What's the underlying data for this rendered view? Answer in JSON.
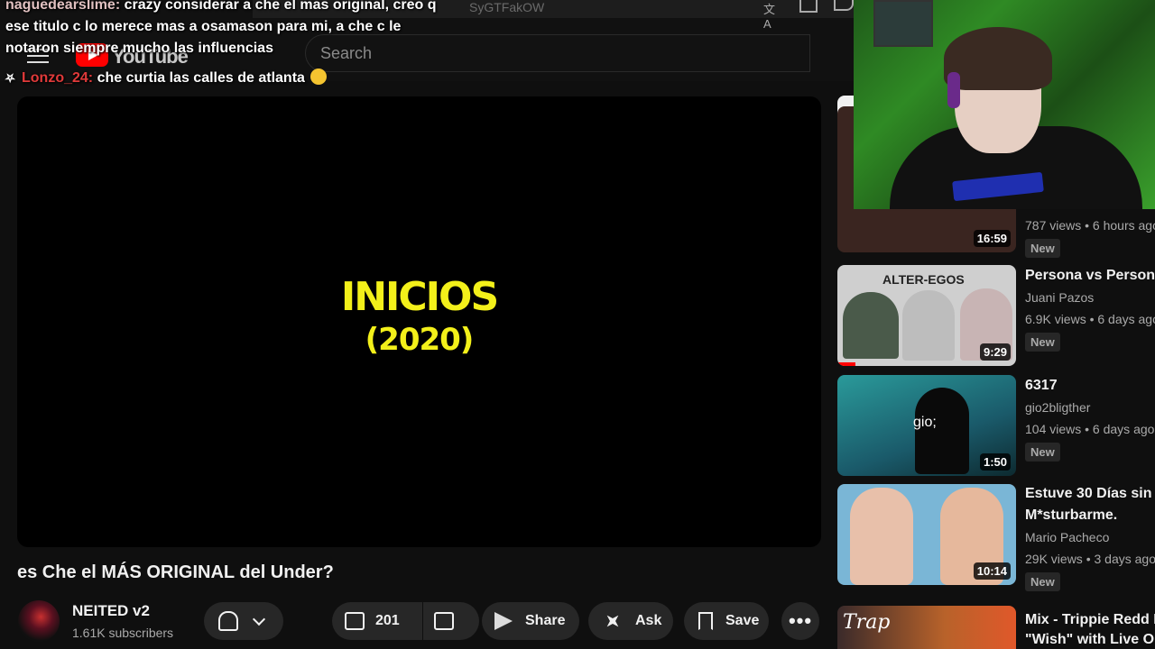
{
  "browser": {
    "url_fragment": "SyGTFakOW"
  },
  "masthead": {
    "logo_text": "YouTube",
    "search_placeholder": "Search"
  },
  "chat": {
    "messages": [
      {
        "user": "naguedearslime:",
        "text": "crazy considerar a che el mas original, creo q"
      },
      {
        "user": "",
        "text": "ese titulo c lo merece mas a osamason para mi, a che c le"
      },
      {
        "user": "",
        "text": "notaron siempre mucho las influencias"
      },
      {
        "user": "Lonzo_24:",
        "text": "che curtia las calles de atlanta"
      }
    ]
  },
  "player": {
    "frame_title": "INICIOS",
    "frame_subtitle": "(2020)"
  },
  "video": {
    "title": "es Che el MÁS ORIGINAL del Under?",
    "channel_name": "NEITED v2",
    "subscribers": "1.61K subscribers",
    "likes": "201",
    "share_label": "Share",
    "ask_label": "Ask",
    "save_label": "Save",
    "more_label": "•••"
  },
  "recommendations": [
    {
      "title": "",
      "channel": "",
      "meta": "787 views • 6 hours ago",
      "duration": "16:59",
      "badge": "New",
      "thumb_color": "#3a2520"
    },
    {
      "title": "Persona vs Persona",
      "channel": "Juani Pazos",
      "meta": "6.9K views • 6 days ago",
      "duration": "9:29",
      "badge": "New",
      "thumb_text": "ALTER-EGOS",
      "progress": 0.1,
      "thumb_color": "#cfcfcf"
    },
    {
      "title": "6317",
      "channel": "gio2bligther",
      "meta": "104 views • 6 days ago",
      "duration": "1:50",
      "badge": "New",
      "thumb_text": "gio;",
      "thumb_color": "#2a8a8a"
    },
    {
      "title_line1": "Estuve 30 Días sin",
      "title_line2": "M*sturbarme.",
      "channel": "Mario Pacheco",
      "meta": "29K views • 3 days ago",
      "duration": "10:14",
      "badge": "New",
      "thumb_color": "#7ab6d6"
    },
    {
      "title_line1": "Mix - Trippie Redd F",
      "title_line2": "\"Wish\" with Live Orc",
      "channel": "",
      "meta": "",
      "duration": "",
      "badge": "",
      "thumb_text": "Trap",
      "thumb_color": "#7a2a1a"
    }
  ],
  "colors": {
    "accent": "#ff0000",
    "title_yellow": "#f3f01a",
    "chat_user1": "#e0c0c0",
    "chat_user2": "#e03a3a"
  }
}
